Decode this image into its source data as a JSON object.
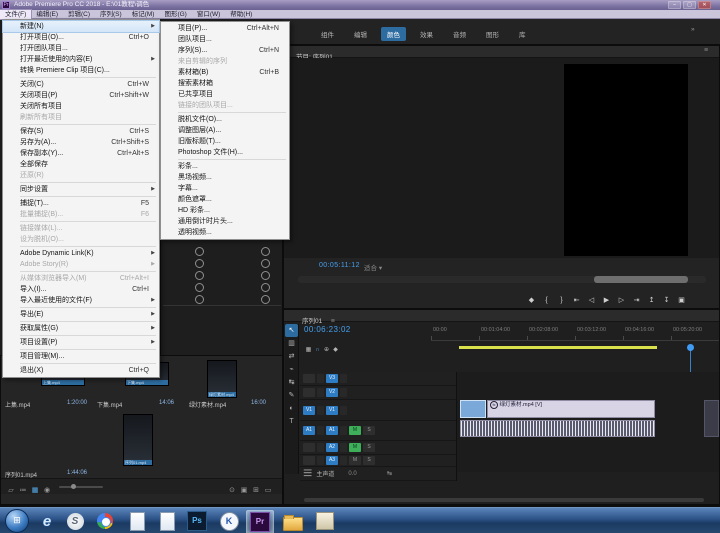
{
  "colors": {
    "accent_blue": "#2d7cc4",
    "timecode_blue": "#46a0f0",
    "render_bar_yellow": "#d9e24a",
    "mute_green": "#3fae5a",
    "video_clip_lavender": "#d8d4e6",
    "selected_clip_blue": "#7aa8d8"
  },
  "titlebar": {
    "title": "Adobe Premiere Pro CC 2018 - E:\\01教程\\调色",
    "minimize": "–",
    "maximize": "▢",
    "close": "✕"
  },
  "menubar": {
    "items": [
      "文件(F)",
      "编辑(E)",
      "剪辑(C)",
      "序列(S)",
      "标记(M)",
      "图形(G)",
      "窗口(W)",
      "帮助(H)"
    ],
    "active_index": 0
  },
  "file_menu": {
    "items": [
      {
        "id": "new",
        "label": "新建(N)",
        "sub": true,
        "hl": true
      },
      {
        "id": "open-project",
        "label": "打开项目(O)...",
        "shortcut": "Ctrl+O"
      },
      {
        "id": "open-team-project",
        "label": "打开团队项目..."
      },
      {
        "id": "open-recent",
        "label": "打开最近使用的内容(E)",
        "sub": true
      },
      {
        "id": "convert-premiere-clip",
        "label": "转换 Premiere Clip 项目(C)..."
      },
      {
        "sep": true
      },
      {
        "id": "close",
        "label": "关闭(C)",
        "shortcut": "Ctrl+W"
      },
      {
        "id": "close-project",
        "label": "关闭项目(P)",
        "shortcut": "Ctrl+Shift+W"
      },
      {
        "id": "close-all-projects",
        "label": "关闭所有项目"
      },
      {
        "id": "refresh-all-projects",
        "label": "刷新所有项目",
        "disabled": true
      },
      {
        "sep": true
      },
      {
        "id": "save",
        "label": "保存(S)",
        "shortcut": "Ctrl+S"
      },
      {
        "id": "save-as",
        "label": "另存为(A)...",
        "shortcut": "Ctrl+Shift+S"
      },
      {
        "id": "save-copy",
        "label": "保存副本(Y)...",
        "shortcut": "Ctrl+Alt+S"
      },
      {
        "id": "save-all",
        "label": "全部保存"
      },
      {
        "id": "revert",
        "label": "还原(R)",
        "disabled": true
      },
      {
        "sep": true
      },
      {
        "id": "sync-settings",
        "label": "同步设置",
        "sub": true
      },
      {
        "sep": true
      },
      {
        "id": "capture",
        "label": "捕捉(T)...",
        "shortcut": "F5"
      },
      {
        "id": "batch-capture",
        "label": "批量捕捉(B)...",
        "shortcut": "F6",
        "disabled": true
      },
      {
        "sep": true
      },
      {
        "id": "link-media",
        "label": "链接媒体(L)...",
        "disabled": true
      },
      {
        "id": "make-offline",
        "label": "设为脱机(O)...",
        "disabled": true
      },
      {
        "sep": true
      },
      {
        "id": "adobe-dynamic-link",
        "label": "Adobe Dynamic Link(K)",
        "sub": true
      },
      {
        "id": "adobe-story",
        "label": "Adobe Story(R)",
        "sub": true,
        "disabled": true
      },
      {
        "sep": true
      },
      {
        "id": "import-from-media-browser",
        "label": "从媒体浏览器导入(M)",
        "shortcut": "Ctrl+Alt+I",
        "disabled": true
      },
      {
        "id": "import",
        "label": "导入(I)...",
        "shortcut": "Ctrl+I"
      },
      {
        "id": "import-recent",
        "label": "导入最近使用的文件(F)",
        "sub": true
      },
      {
        "sep": true
      },
      {
        "id": "export",
        "label": "导出(E)",
        "sub": true
      },
      {
        "sep": true
      },
      {
        "id": "get-properties",
        "label": "获取属性(G)",
        "sub": true
      },
      {
        "sep": true
      },
      {
        "id": "project-settings",
        "label": "项目设置(P)",
        "sub": true
      },
      {
        "sep": true
      },
      {
        "id": "project-manager",
        "label": "项目管理(M)..."
      },
      {
        "sep": true
      },
      {
        "id": "exit",
        "label": "退出(X)",
        "shortcut": "Ctrl+Q"
      }
    ]
  },
  "new_submenu": {
    "items": [
      {
        "id": "project",
        "label": "项目(P)...",
        "shortcut": "Ctrl+Alt+N"
      },
      {
        "id": "team-project",
        "label": "团队项目..."
      },
      {
        "id": "sequence",
        "label": "序列(S)...",
        "shortcut": "Ctrl+N"
      },
      {
        "id": "sequence-from-clip",
        "label": "来自剪辑的序列",
        "disabled": true
      },
      {
        "id": "bin",
        "label": "素材箱(B)",
        "shortcut": "Ctrl+B"
      },
      {
        "id": "search-bin",
        "label": "搜索素材箱"
      },
      {
        "id": "shared-project",
        "label": "已共享项目"
      },
      {
        "id": "linked-team-project",
        "label": "链接的团队项目...",
        "disabled": true
      },
      {
        "sep": true
      },
      {
        "id": "offline-file",
        "label": "脱机文件(O)..."
      },
      {
        "id": "adjustment-layer",
        "label": "调整图层(A)..."
      },
      {
        "id": "legacy-title",
        "label": "旧版标题(T)..."
      },
      {
        "id": "photoshop-file",
        "label": "Photoshop 文件(H)..."
      },
      {
        "sep": true
      },
      {
        "id": "bars-and-tone",
        "label": "彩条..."
      },
      {
        "id": "black-video",
        "label": "黑场视频..."
      },
      {
        "id": "captions",
        "label": "字幕..."
      },
      {
        "id": "color-matte",
        "label": "颜色遮罩..."
      },
      {
        "id": "hd-bars",
        "label": "HD 彩条..."
      },
      {
        "id": "universal-counting-leader",
        "label": "通用倒计时片头..."
      },
      {
        "id": "transparent-video",
        "label": "透明视频..."
      }
    ]
  },
  "workspace_tabs": {
    "items": [
      "组件",
      "编辑",
      "颜色",
      "效果",
      "音频",
      "图形",
      "库"
    ],
    "selected": "颜色",
    "overflow": "»"
  },
  "program_monitor": {
    "tab": "节目: 序列01",
    "panel_menu_icon": "≡",
    "timecode": "00:05:11:12",
    "zoom_label": "适合",
    "zoom_caret": "▾",
    "transport": [
      {
        "name": "add-marker-icon",
        "glyph": "◆"
      },
      {
        "name": "mark-in-icon",
        "glyph": "{"
      },
      {
        "name": "mark-out-icon",
        "glyph": "}"
      },
      {
        "name": "go-to-in-icon",
        "glyph": "⇤"
      },
      {
        "name": "step-back-icon",
        "glyph": "◁"
      },
      {
        "name": "play-icon",
        "glyph": "▶"
      },
      {
        "name": "step-forward-icon",
        "glyph": "▷"
      },
      {
        "name": "go-to-out-icon",
        "glyph": "⇥"
      },
      {
        "name": "lift-icon",
        "glyph": "↥"
      },
      {
        "name": "extract-icon",
        "glyph": "↧"
      },
      {
        "name": "export-frame-icon",
        "glyph": "▣"
      }
    ]
  },
  "timeline": {
    "tab": "序列01",
    "panel_menu_icon": "≡",
    "timecode": "00:06:23:02",
    "mini_toolbar": [
      {
        "name": "nest-toggle-icon",
        "glyph": "▦"
      },
      {
        "name": "snap-icon",
        "glyph": "∩",
        "active": true
      },
      {
        "name": "linked-selection-icon",
        "glyph": "⊕"
      },
      {
        "name": "add-marker-icon",
        "glyph": "◆"
      }
    ],
    "tools": [
      {
        "name": "selection-tool",
        "glyph": "↖",
        "active": true
      },
      {
        "name": "track-select-tool",
        "glyph": "▥"
      },
      {
        "name": "ripple-edit-tool",
        "glyph": "⇄"
      },
      {
        "name": "razor-tool",
        "glyph": "⌁"
      },
      {
        "name": "slip-tool",
        "glyph": "↹"
      },
      {
        "name": "pen-tool",
        "glyph": "✎"
      },
      {
        "name": "hand-tool",
        "glyph": "◐"
      },
      {
        "name": "type-tool",
        "glyph": "T"
      }
    ],
    "ruler_labels": [
      "00:00",
      "00:01:04:00",
      "00:02:08:00",
      "00:03:12:00",
      "00:04:16:00",
      "00:05:20:00"
    ],
    "tracks": [
      {
        "id": "v3",
        "label": "V3",
        "kind": "video",
        "h": 13,
        "patch": "",
        "target": true
      },
      {
        "id": "v2",
        "label": "V2",
        "kind": "video",
        "h": 13,
        "patch": "",
        "target": true
      },
      {
        "id": "v1",
        "label": "V1",
        "kind": "video",
        "h": 20,
        "patch": "V1",
        "target": true
      },
      {
        "id": "a1",
        "label": "A1",
        "kind": "audio",
        "h": 19,
        "patch": "A1",
        "target": true,
        "mute": true
      },
      {
        "id": "a2",
        "label": "A2",
        "kind": "audio",
        "h": 13,
        "patch": "",
        "target": true,
        "mute": true
      },
      {
        "id": "a3",
        "label": "A3",
        "kind": "audio",
        "h": 11,
        "patch": "",
        "target": true,
        "mute": false
      }
    ],
    "master_label": "主声道",
    "master_level": "0.0",
    "clips": {
      "video_name": "绿灯素材.mp4 [V]",
      "fx_badge": "fx"
    }
  },
  "project_panel": {
    "items": [
      {
        "name": "上集.mp4",
        "duration": "1:20:00"
      },
      {
        "name": "下集.mp4",
        "duration": "14:06"
      },
      {
        "name": "绿灯素材.mp4",
        "duration": "16:00"
      },
      {
        "name": "序列01.mp4",
        "duration": "1:44:06"
      }
    ],
    "toolbar_left": [
      {
        "name": "readonly-toggle-icon",
        "glyph": "▱"
      },
      {
        "name": "list-view-icon",
        "glyph": "≔"
      },
      {
        "name": "icon-view-icon",
        "glyph": "▦",
        "active": true
      },
      {
        "name": "sort-icon",
        "glyph": "◉"
      }
    ],
    "toolbar_right": [
      {
        "name": "find-icon",
        "glyph": "⊙"
      },
      {
        "name": "new-bin-icon",
        "glyph": "▣"
      },
      {
        "name": "new-item-icon",
        "glyph": "⊞"
      },
      {
        "name": "delete-icon",
        "glyph": "▭"
      }
    ]
  },
  "taskbar": {
    "icons": [
      {
        "name": "start-button",
        "glyph": "⊞",
        "interactable": true
      },
      {
        "name": "internet-explorer-icon",
        "glyph": "e",
        "interactable": true
      },
      {
        "name": "sogou-browser-icon",
        "glyph": "S",
        "interactable": true
      },
      {
        "name": "chrome-icon",
        "glyph": "",
        "interactable": true
      },
      {
        "name": "notepad-icon",
        "glyph": "",
        "interactable": true
      },
      {
        "name": "document-icon",
        "glyph": "",
        "interactable": true
      },
      {
        "name": "photoshop-icon",
        "glyph": "Ps",
        "interactable": true
      },
      {
        "name": "kmplayer-icon",
        "glyph": "K",
        "interactable": true
      },
      {
        "name": "premiere-icon",
        "glyph": "Pr",
        "active": true,
        "interactable": true
      },
      {
        "name": "folder-icon",
        "glyph": "",
        "interactable": true
      },
      {
        "name": "installer-icon",
        "glyph": "",
        "interactable": true
      }
    ]
  }
}
